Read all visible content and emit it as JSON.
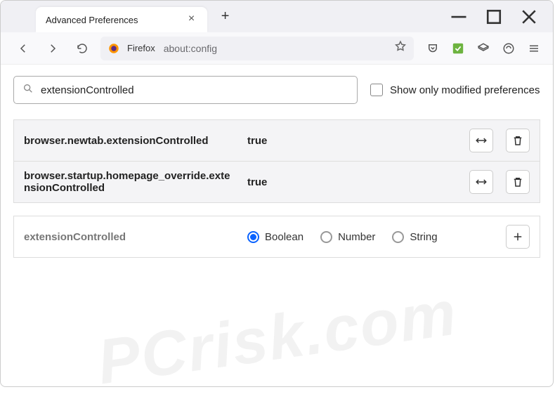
{
  "tab": {
    "title": "Advanced Preferences"
  },
  "addressbar": {
    "brand": "Firefox",
    "url": "about:config"
  },
  "search": {
    "value": "extensionControlled"
  },
  "checkbox": {
    "label": "Show only modified preferences"
  },
  "prefs": [
    {
      "name": "browser.newtab.extensionControlled",
      "value": "true"
    },
    {
      "name": "browser.startup.homepage_override.extensionControlled",
      "value": "true"
    }
  ],
  "newpref": {
    "name": "extensionControlled",
    "types": [
      "Boolean",
      "Number",
      "String"
    ],
    "selected": "Boolean"
  },
  "watermark": "PCrisk.com"
}
